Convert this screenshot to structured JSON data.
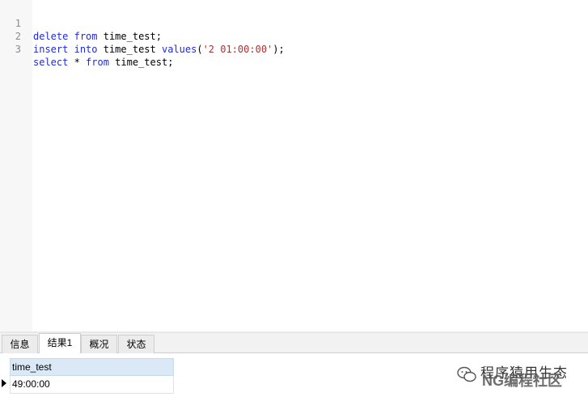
{
  "editor": {
    "lines": [
      {
        "num": "1",
        "tokens": [
          [
            "kw",
            "delete"
          ],
          [
            "t",
            " "
          ],
          [
            "kw",
            "from"
          ],
          [
            "t",
            " time_test;"
          ]
        ]
      },
      {
        "num": "2",
        "tokens": [
          [
            "kw",
            "insert"
          ],
          [
            "t",
            " "
          ],
          [
            "kw",
            "into"
          ],
          [
            "t",
            " time_test "
          ],
          [
            "kw",
            "values"
          ],
          [
            "t",
            "("
          ],
          [
            "str",
            "'2 01:00:00'"
          ],
          [
            "t",
            ");"
          ]
        ]
      },
      {
        "num": "3",
        "tokens": [
          [
            "kw",
            "select"
          ],
          [
            "t",
            " * "
          ],
          [
            "kw",
            "from"
          ],
          [
            "t",
            " time_test;"
          ]
        ]
      }
    ]
  },
  "tabs": [
    {
      "label": "信息",
      "active": false
    },
    {
      "label": "结果1",
      "active": true
    },
    {
      "label": "概况",
      "active": false
    },
    {
      "label": "状态",
      "active": false
    }
  ],
  "results": {
    "column": "time_test",
    "rows": [
      "49:00:00"
    ]
  },
  "watermark": {
    "line1": "程序猿用生态",
    "line2": "NG编程社区"
  },
  "colors": {
    "keyword": "#1f2bd6",
    "string": "#b03030",
    "header_bg": "#dbe8f6"
  }
}
